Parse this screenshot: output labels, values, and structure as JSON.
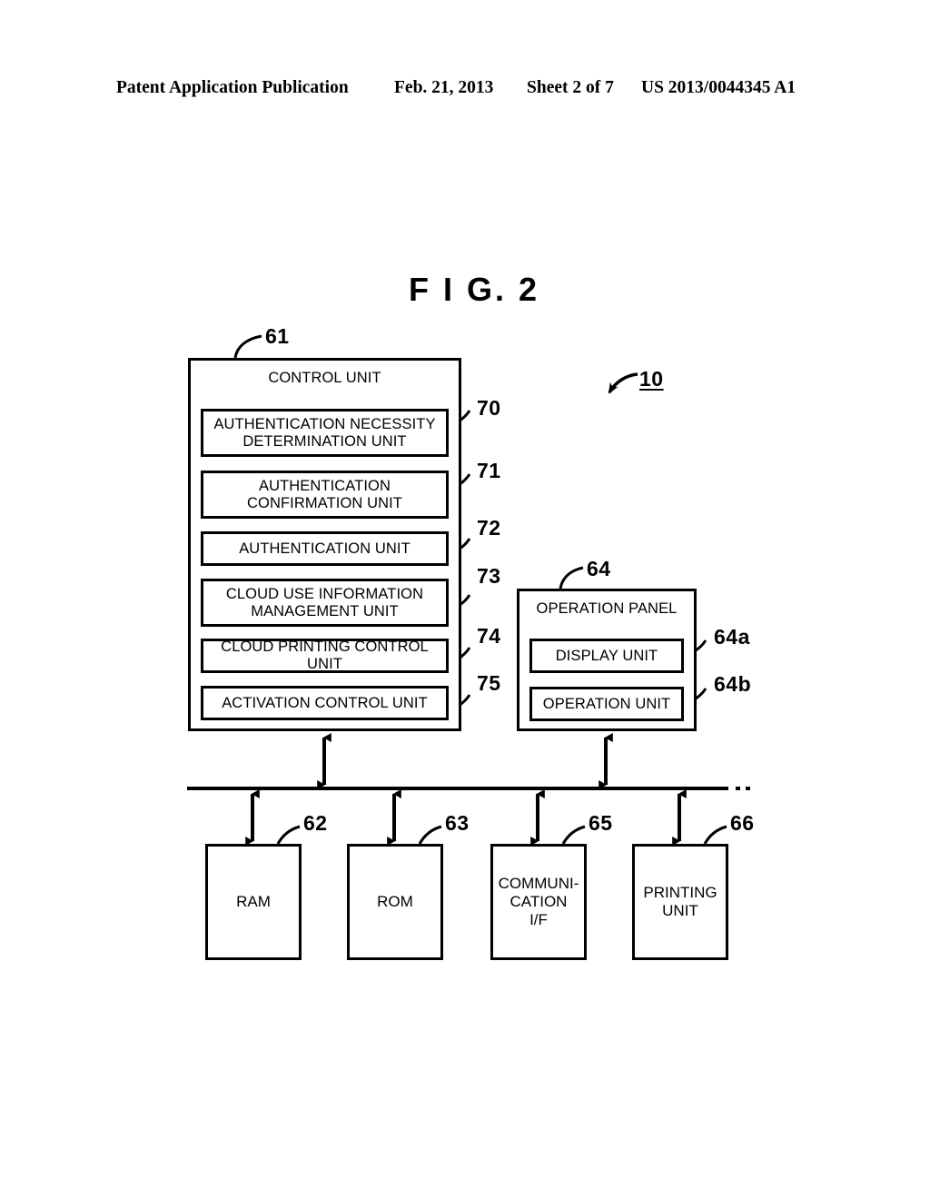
{
  "header": {
    "publication": "Patent Application Publication",
    "date": "Feb. 21, 2013",
    "sheet": "Sheet 2 of 7",
    "patent_number": "US 2013/0044345 A1"
  },
  "figure": {
    "title": "F I G.  2",
    "system_ref": "10"
  },
  "control_unit": {
    "ref": "61",
    "title": "CONTROL UNIT",
    "modules": [
      {
        "ref": "70",
        "label": "AUTHENTICATION NECESSITY DETERMINATION UNIT"
      },
      {
        "ref": "71",
        "label": "AUTHENTICATION CONFIRMATION UNIT"
      },
      {
        "ref": "72",
        "label": "AUTHENTICATION UNIT"
      },
      {
        "ref": "73",
        "label": "CLOUD USE INFORMATION MANAGEMENT UNIT"
      },
      {
        "ref": "74",
        "label": "CLOUD PRINTING CONTROL UNIT"
      },
      {
        "ref": "75",
        "label": "ACTIVATION CONTROL UNIT"
      }
    ]
  },
  "operation_panel": {
    "ref": "64",
    "title": "OPERATION PANEL",
    "modules": [
      {
        "ref": "64a",
        "label": "DISPLAY UNIT"
      },
      {
        "ref": "64b",
        "label": "OPERATION UNIT"
      }
    ]
  },
  "peripherals": [
    {
      "ref": "62",
      "label": "RAM"
    },
    {
      "ref": "63",
      "label": "ROM"
    },
    {
      "ref": "65",
      "label": "COMMUNI-\nCATION\nI/F"
    },
    {
      "ref": "66",
      "label": "PRINTING\nUNIT"
    }
  ],
  "colors": {
    "ink": "#000000",
    "paper": "#ffffff"
  }
}
